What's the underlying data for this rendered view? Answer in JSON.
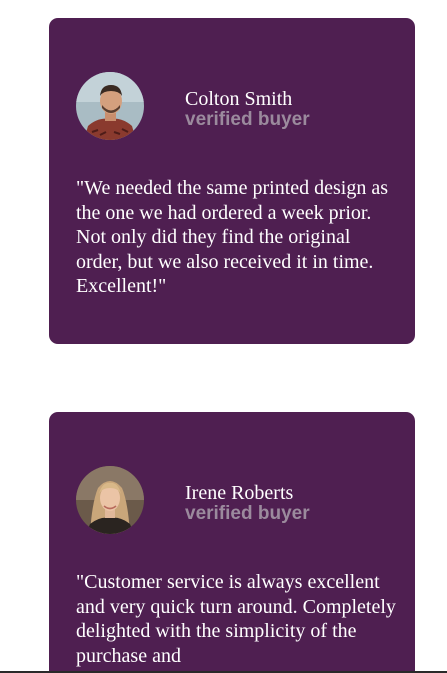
{
  "testimonials": [
    {
      "name": "Colton Smith",
      "tag": "verified buyer",
      "avatar_icon": "man-portrait-avatar",
      "quote": "\"We needed the same printed design as the one we had ordered a week prior. Not only did they find the original order, but we also received it in time. Excellent!\""
    },
    {
      "name": "Irene Roberts",
      "tag": "verified buyer",
      "avatar_icon": "woman-portrait-avatar",
      "quote": "\"Customer service is always excellent and very quick turn around. Completely delighted with the simplicity of the purchase and"
    }
  ],
  "colors": {
    "card_background": "#4f1f51",
    "name_text": "#ffffff",
    "tag_text": "#9b8a9d",
    "page_background": "#ffffff"
  }
}
